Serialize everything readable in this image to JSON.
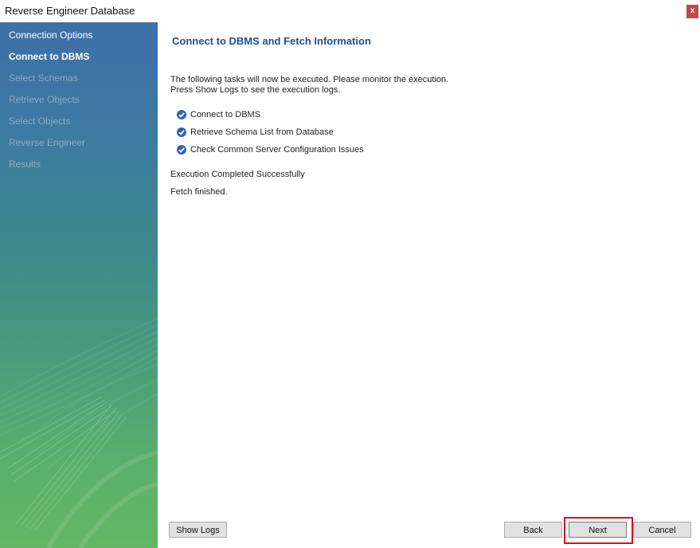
{
  "window": {
    "title": "Reverse Engineer Database",
    "close_label": "x"
  },
  "sidebar": {
    "steps": [
      {
        "label": "Connection Options",
        "state": "done"
      },
      {
        "label": "Connect to DBMS",
        "state": "current"
      },
      {
        "label": "Select Schemas",
        "state": "pending"
      },
      {
        "label": "Retrieve Objects",
        "state": "pending"
      },
      {
        "label": "Select Objects",
        "state": "pending"
      },
      {
        "label": "Reverse Engineer",
        "state": "pending"
      },
      {
        "label": "Results",
        "state": "pending"
      }
    ]
  },
  "main": {
    "heading": "Connect to DBMS and Fetch Information",
    "intro_line1": "The following tasks will now be executed. Please monitor the execution.",
    "intro_line2": "Press Show Logs to see the execution logs.",
    "tasks": [
      {
        "label": "Connect to DBMS",
        "icon": "check-circle-icon"
      },
      {
        "label": "Retrieve Schema List from Database",
        "icon": "check-circle-icon"
      },
      {
        "label": "Check Common Server Configuration Issues",
        "icon": "check-circle-icon"
      }
    ],
    "status_message": "Execution Completed Successfully",
    "fetch_message": "Fetch finished."
  },
  "footer": {
    "show_logs_label": "Show Logs",
    "back_label": "Back",
    "next_label": "Next",
    "cancel_label": "Cancel"
  },
  "colors": {
    "heading": "#1f4e9a",
    "highlight": "#d1141b",
    "check": "#2e63b8"
  }
}
